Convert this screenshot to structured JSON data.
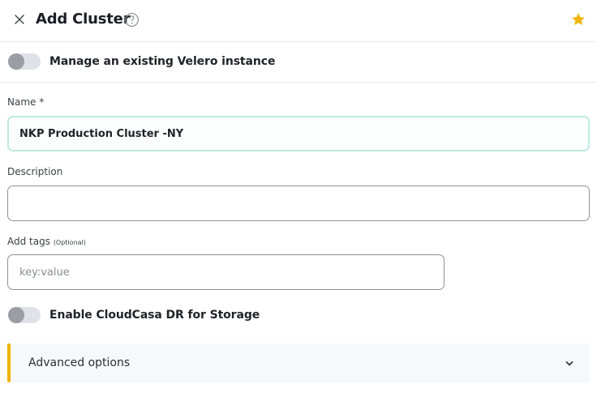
{
  "header": {
    "title": "Add Cluster"
  },
  "velero_toggle": {
    "label": "Manage an existing Velero instance",
    "enabled": false
  },
  "name_field": {
    "label": "Name *",
    "value": "NKP Production Cluster -NY"
  },
  "description_field": {
    "label": "Description",
    "value": "",
    "placeholder": ""
  },
  "tags_field": {
    "label": "Add tags",
    "optional_note": "(Optional)",
    "placeholder": "key:value",
    "value": ""
  },
  "dr_toggle": {
    "label": "Enable CloudCasa DR for Storage",
    "enabled": false
  },
  "advanced": {
    "label": "Advanced options"
  },
  "colors": {
    "accent_bar": "#f0b400",
    "star": "#f0b400",
    "focus_border": "#bfe9df"
  },
  "icons": {
    "close": "close-icon",
    "help": "question-circle-icon",
    "star": "star-icon",
    "chevron": "chevron-down-icon"
  }
}
